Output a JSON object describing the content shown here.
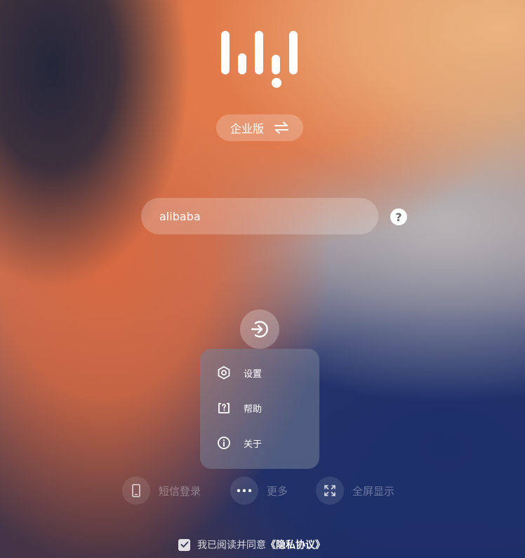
{
  "logo": {
    "icon": "audio-bars-logo"
  },
  "edition": {
    "label": "企业版",
    "icon": "swap-arrows-icon"
  },
  "login": {
    "username_value": "alibaba",
    "help_label": "?",
    "submit_icon": "sign-in-arrow-icon"
  },
  "menu": {
    "items": [
      {
        "label": "设置",
        "icon": "settings-hexagon-icon"
      },
      {
        "label": "帮助",
        "icon": "help-box-icon"
      },
      {
        "label": "关于",
        "icon": "info-circle-icon"
      }
    ]
  },
  "tools": {
    "sms_login": {
      "label": "短信登录",
      "icon": "phone-icon"
    },
    "more": {
      "label": "更多",
      "icon": "more-dots-icon"
    },
    "fullscreen": {
      "label": "全屏显示",
      "icon": "fullscreen-icon"
    }
  },
  "agreement": {
    "checked": true,
    "text": "我已阅读并同意",
    "link": "《隐私协议》"
  }
}
